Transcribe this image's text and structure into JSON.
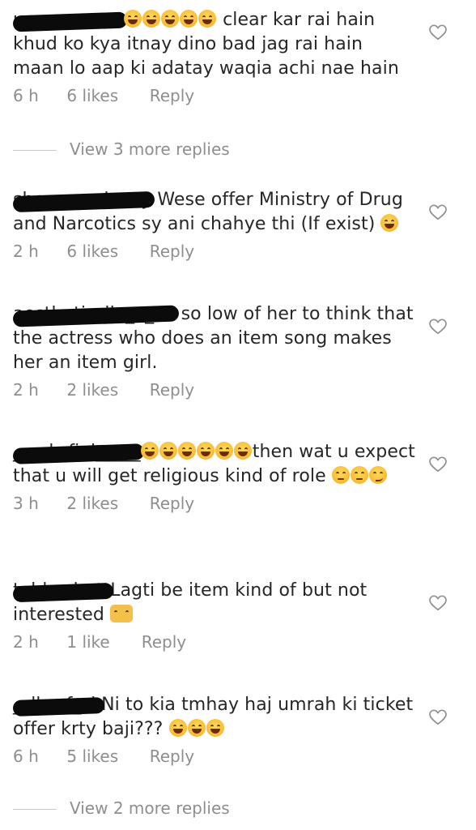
{
  "comments": [
    {
      "text": "clear kar rai hain khud ko kya itnay dino bad jag rai hain maan lo aap ki adatay waqia achi nae hain",
      "emoji": 5,
      "emoji_after": false,
      "time": "6 h",
      "likes": "6 likes",
      "reply": "Reply"
    },
    {
      "text": "Wese offer Ministry of Drug and Narcotics sy ani chahye thi (If exist)",
      "time": "2 h",
      "likes": "6 likes",
      "reply": "Reply"
    },
    {
      "text": "so low of her to think that the actress who does an item song makes her an item girl.",
      "time": "2 h",
      "likes": "2 likes",
      "reply": "Reply"
    },
    {
      "text": "then wat u expect that u will get religious kind of role",
      "time": "3 h",
      "likes": "2 likes",
      "reply": "Reply"
    },
    {
      "text": "Lagti be item kind of but not interested",
      "time": "2 h",
      "likes": "1 like",
      "reply": "Reply"
    },
    {
      "text": "Ni to kia tmhay haj umrah ki ticket offer krty baji???",
      "time": "6 h",
      "likes": "5 likes",
      "reply": "Reply"
    }
  ],
  "view_more": [
    "View 3 more replies",
    "View 2 more replies"
  ],
  "icons": {
    "like": "heart-outline-icon"
  },
  "colors": {
    "text": "#262626",
    "meta": "#8e8e8e",
    "redaction": "#0b0b0b"
  }
}
